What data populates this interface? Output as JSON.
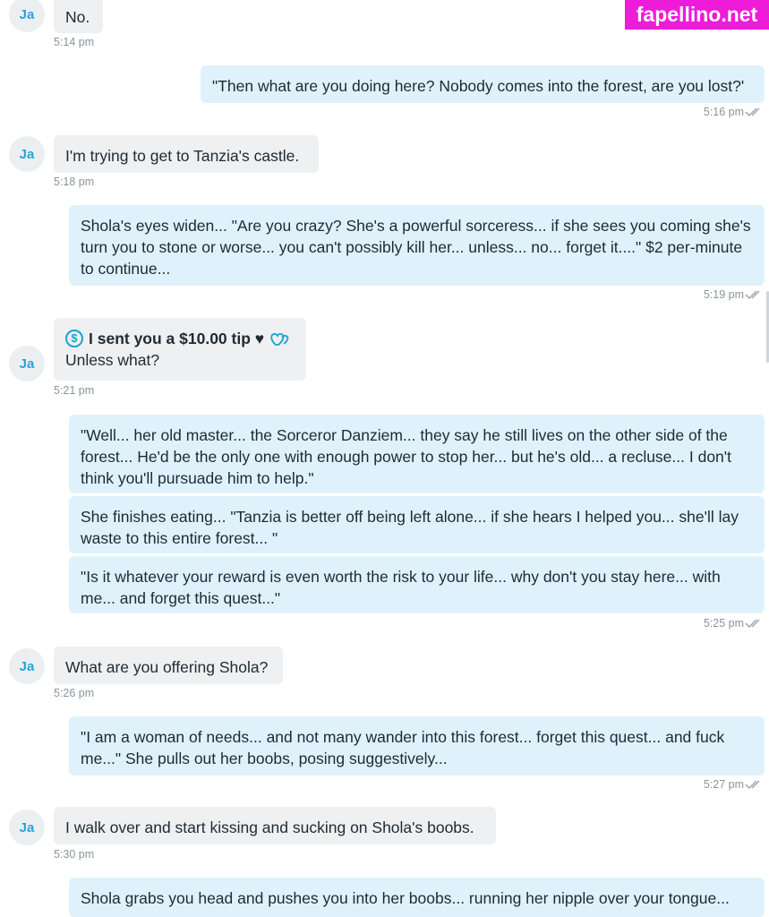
{
  "watermark": "fapellino.net",
  "sender_initials": "Ja",
  "messages": [
    {
      "text": "No.",
      "time": "5:14 pm"
    },
    {
      "text": "\"Then what are you doing here? Nobody comes into the forest, are you lost?'",
      "time": "5:16 pm"
    },
    {
      "text": "I'm trying to get to Tanzia's castle.",
      "time": "5:18 pm"
    },
    {
      "text": "Shola's eyes widen... \"Are you crazy? She's a powerful sorceress... if she sees you coming she's turn you to stone or worse... you can't possibly kill her... unless... no... forget it....\" $2 per-minute to continue...",
      "time": "5:19 pm"
    },
    {
      "tip": "I sent you a $10.00 tip ♥",
      "text": "Unless what?",
      "time": "5:21 pm"
    },
    {
      "text": "\"Well... her old master... the Sorceror Danziem... they say he still lives on the other side of the forest... He'd be the only one with enough power to stop her... but he's old... a recluse... I don't think you'll pursuade him to help.\""
    },
    {
      "text": "She finishes eating... \"Tanzia is better off being left alone... if she hears I helped you... she'll lay waste to this entire forest... \""
    },
    {
      "text": "\"Is it whatever your reward is even worth the risk to your life... why don't you stay here... with me... and forget this quest...\"",
      "time": "5:25 pm"
    },
    {
      "text": "What are you offering Shola?",
      "time": "5:26 pm"
    },
    {
      "text": "\"I am a woman of needs... and not many wander into this forest... forget this quest... and fuck me...\" She pulls out her boobs, posing suggestively...",
      "time": "5:27 pm"
    },
    {
      "text": "I walk over and start kissing and sucking on Shola's boobs.",
      "time": "5:30 pm"
    },
    {
      "text": "Shola grabs you head and pushes you into her boobs... running her nipple over your tongue..."
    }
  ],
  "colors": {
    "accent": "#1da1d6",
    "incoming_bg": "#eef0f2",
    "outgoing_bg": "#dff2fb",
    "watermark_bg": "#ee1bd9"
  }
}
